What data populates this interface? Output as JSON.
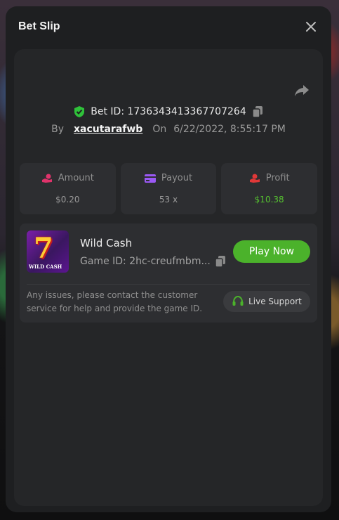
{
  "modal": {
    "title": "Bet Slip",
    "close_icon": "close-icon"
  },
  "bet": {
    "id_label": "Bet ID: 1736343413367707264",
    "by_label": "By",
    "username": "xacutarafwb",
    "on_label": "On",
    "datetime": "6/22/2022, 8:55:17 PM"
  },
  "stats": {
    "amount": {
      "label": "Amount",
      "value": "$0.20",
      "icon": "coin-hand-icon",
      "color": "#e0336b"
    },
    "payout": {
      "label": "Payout",
      "value": "53 x",
      "icon": "card-icon",
      "color": "#9b59f5"
    },
    "profit": {
      "label": "Profit",
      "value": "$10.38",
      "icon": "money-hand-icon",
      "color": "#e03838",
      "value_color": "#55c030"
    }
  },
  "game": {
    "name": "Wild Cash",
    "id_label": "Game ID: 2hc-creufmbm...",
    "play_label": "Play Now",
    "thumb_text": "WILD CASH"
  },
  "support": {
    "notice": "Any issues, please contact the customer service for help and provide the game ID.",
    "button_label": "Live Support"
  },
  "colors": {
    "accent_green": "#4bb22b",
    "verified_green": "#2fc13a"
  }
}
